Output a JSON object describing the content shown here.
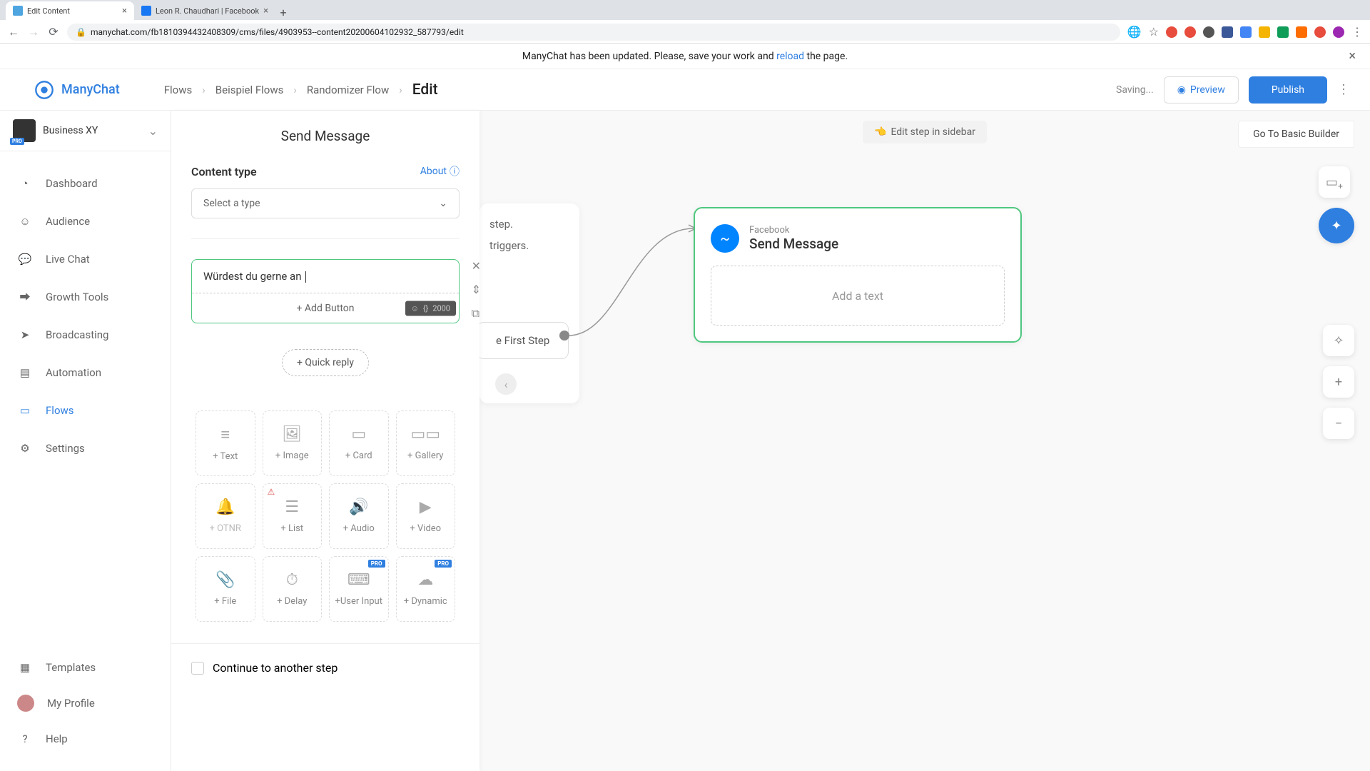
{
  "browser": {
    "tabs": [
      {
        "title": "Edit Content"
      },
      {
        "title": "Leon R. Chaudhari | Facebook"
      }
    ],
    "url": "manychat.com/fb181039443240830​9/cms/files/4903953--content20200604102932_587793/edit"
  },
  "banner": {
    "text_before": "ManyChat has been updated. Please, save your work and ",
    "link": "reload",
    "text_after": " the page."
  },
  "header": {
    "logo": "ManyChat",
    "crumbs": [
      "Flows",
      "Beispiel Flows",
      "Randomizer Flow"
    ],
    "current": "Edit",
    "saving": "Saving...",
    "preview": "Preview",
    "publish": "Publish"
  },
  "sidebar": {
    "workspace": "Business XY",
    "pro": "PRO",
    "items": [
      {
        "label": "Dashboard"
      },
      {
        "label": "Audience"
      },
      {
        "label": "Live Chat"
      },
      {
        "label": "Growth Tools"
      },
      {
        "label": "Broadcasting"
      },
      {
        "label": "Automation"
      },
      {
        "label": "Flows"
      },
      {
        "label": "Settings"
      }
    ],
    "bottom": [
      {
        "label": "Templates"
      },
      {
        "label": "My Profile"
      },
      {
        "label": "Help"
      }
    ]
  },
  "editor": {
    "title": "Send Message",
    "content_type_label": "Content type",
    "about": "About",
    "select_placeholder": "Select a type",
    "text_value": "Würdest du gerne an ",
    "add_button": "+ Add Button",
    "char_limit": "2000",
    "quick_reply": "+ Quick reply",
    "blocks": [
      {
        "label": "+ Text"
      },
      {
        "label": "+ Image"
      },
      {
        "label": "+ Card"
      },
      {
        "label": "+ Gallery"
      },
      {
        "label": "+ OTNR"
      },
      {
        "label": "+ List"
      },
      {
        "label": "+ Audio"
      },
      {
        "label": "+ Video"
      },
      {
        "label": "+ File"
      },
      {
        "label": "+ Delay"
      },
      {
        "label": "+User Input"
      },
      {
        "label": "+ Dynamic"
      }
    ],
    "pro_badge": "PRO",
    "continue": "Continue to another step"
  },
  "canvas": {
    "edit_step": "Edit step in sidebar",
    "go_basic": "Go To Basic Builder",
    "peek_lines": [
      "step.",
      "triggers."
    ],
    "first_step": "e First Step",
    "node_sub": "Facebook",
    "node_title": "Send Message",
    "add_text": "Add a text"
  }
}
